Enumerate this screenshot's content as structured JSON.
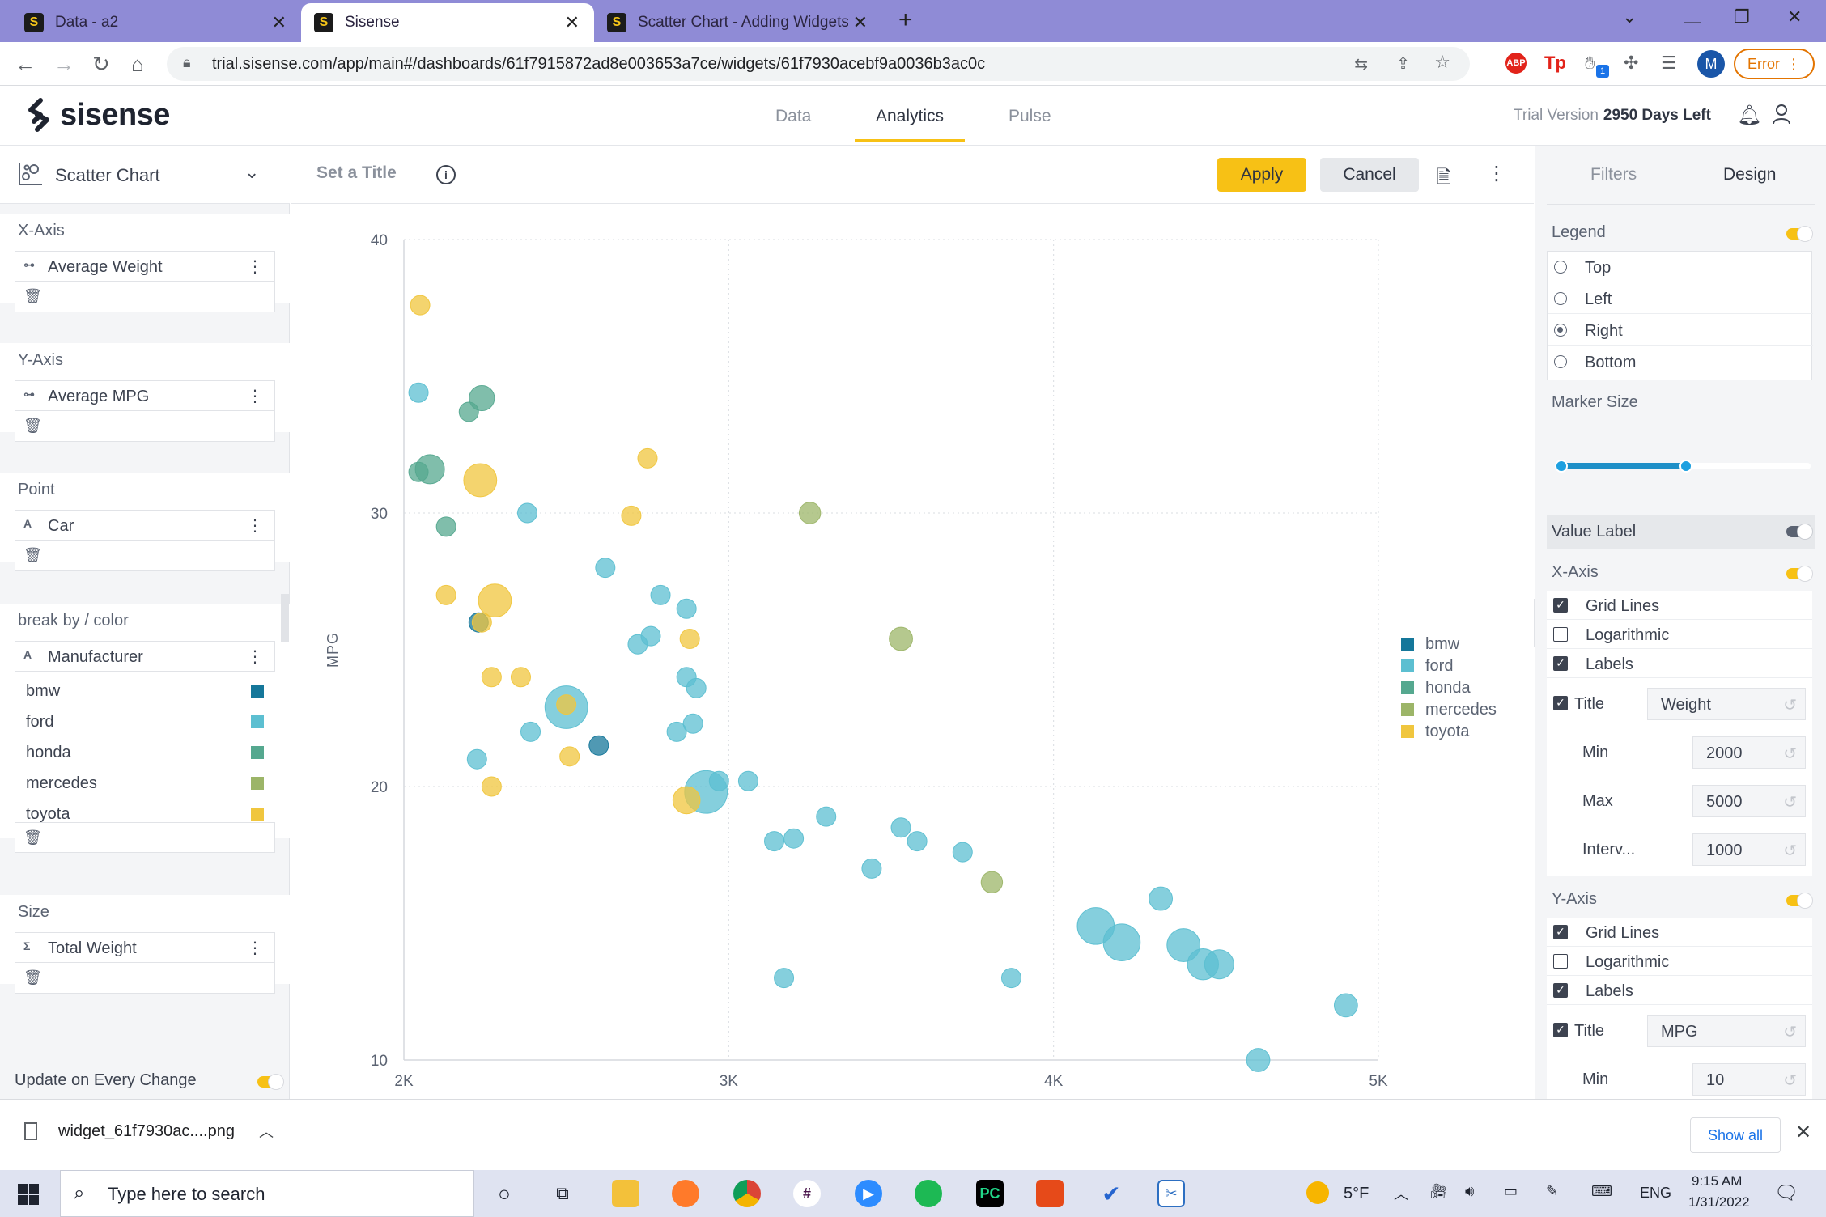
{
  "browser": {
    "tabs": [
      {
        "title": "Data - a2",
        "favicon": "S"
      },
      {
        "title": "Sisense",
        "favicon": "S"
      },
      {
        "title": "Scatter Chart - Adding Widgets t",
        "favicon": "S"
      }
    ],
    "new_tab": "+",
    "url": "trial.sisense.com/app/main#/dashboards/61f7915872ad8e003653a7ce/widgets/61f7930acebf9a0036b3ac0c",
    "profile_initial": "M",
    "error_label": "Error",
    "ext_badge": "1"
  },
  "app": {
    "logo_text": "sisense",
    "nav": [
      "Data",
      "Analytics",
      "Pulse"
    ],
    "active_nav": "Analytics",
    "trial_label": "Trial Version",
    "trial_days": "2950 Days Left"
  },
  "left_panel": {
    "chart_type": "Scatter Chart",
    "sections": {
      "xaxis": {
        "title": "X-Axis",
        "field": "Average Weight",
        "icon": "⊶"
      },
      "yaxis": {
        "title": "Y-Axis",
        "field": "Average MPG",
        "icon": "⊶"
      },
      "point": {
        "title": "Point",
        "field": "Car",
        "icon": "A"
      },
      "breakby": {
        "title": "break by / color",
        "field": "Manufacturer",
        "icon": "A"
      },
      "size": {
        "title": "Size",
        "field": "Total Weight",
        "icon": "Σ"
      }
    },
    "colors": [
      {
        "name": "bmw",
        "color": "#15779a"
      },
      {
        "name": "ford",
        "color": "#5cbfd1"
      },
      {
        "name": "honda",
        "color": "#55a88f"
      },
      {
        "name": "mercedes",
        "color": "#9cb568"
      },
      {
        "name": "toyota",
        "color": "#f0c63e"
      }
    ],
    "update_label": "Update on Every Change",
    "update_on": true
  },
  "center": {
    "title_placeholder": "Set a Title",
    "apply_label": "Apply",
    "cancel_label": "Cancel"
  },
  "chart_data": {
    "type": "scatter",
    "title": "",
    "xlabel": "",
    "ylabel": "MPG",
    "xlim": [
      2000,
      5000
    ],
    "ylim": [
      10,
      40
    ],
    "xticks": [
      {
        "v": 2000,
        "label": "2K"
      },
      {
        "v": 3000,
        "label": "3K"
      },
      {
        "v": 4000,
        "label": "4K"
      },
      {
        "v": 5000,
        "label": "5K"
      }
    ],
    "yticks": [
      10,
      20,
      30,
      40
    ],
    "grid": true,
    "legend": "right",
    "series": [
      {
        "name": "bmw",
        "color": "#15779a",
        "points": [
          [
            2230,
            26.0,
            1
          ],
          [
            2600,
            21.5,
            1
          ]
        ]
      },
      {
        "name": "ford",
        "color": "#5cbfd1",
        "points": [
          [
            2045,
            34.4,
            1
          ],
          [
            2380,
            30.0,
            1
          ],
          [
            2620,
            28.0,
            1
          ],
          [
            2720,
            25.2,
            1
          ],
          [
            2760,
            25.5,
            1
          ],
          [
            2790,
            27.0,
            1
          ],
          [
            2870,
            26.5,
            1
          ],
          [
            2870,
            24.0,
            1
          ],
          [
            2900,
            23.6,
            1
          ],
          [
            2890,
            22.3,
            1
          ],
          [
            2840,
            22.0,
            1
          ],
          [
            2500,
            22.9,
            2.2
          ],
          [
            2390,
            22.0,
            1
          ],
          [
            2225,
            21.0,
            1
          ],
          [
            2930,
            19.8,
            2.2
          ],
          [
            2970,
            20.2,
            1
          ],
          [
            3060,
            20.2,
            1
          ],
          [
            3140,
            18.0,
            1
          ],
          [
            3200,
            18.1,
            1
          ],
          [
            3300,
            18.9,
            1
          ],
          [
            3440,
            17.0,
            1
          ],
          [
            3530,
            18.5,
            1
          ],
          [
            3580,
            18.0,
            1
          ],
          [
            3720,
            17.6,
            1
          ],
          [
            3170,
            13.0,
            1
          ],
          [
            3870,
            13.0,
            1
          ],
          [
            4130,
            14.9,
            1.9
          ],
          [
            4210,
            14.3,
            1.9
          ],
          [
            4330,
            15.9,
            1.2
          ],
          [
            4400,
            14.2,
            1.7
          ],
          [
            4460,
            13.5,
            1.6
          ],
          [
            4510,
            13.5,
            1.5
          ],
          [
            4630,
            10.0,
            1.2
          ],
          [
            4900,
            12.0,
            1.2
          ]
        ]
      },
      {
        "name": "honda",
        "color": "#55a88f",
        "points": [
          [
            2045,
            31.5,
            1
          ],
          [
            2080,
            31.6,
            1.5
          ],
          [
            2200,
            33.7,
            1
          ],
          [
            2240,
            34.2,
            1.3
          ],
          [
            2130,
            29.5,
            1
          ]
        ]
      },
      {
        "name": "mercedes",
        "color": "#9cb568",
        "points": [
          [
            3250,
            30.0,
            1.1
          ],
          [
            3530,
            25.4,
            1.2
          ],
          [
            3810,
            16.5,
            1.1
          ]
        ]
      },
      {
        "name": "toyota",
        "color": "#f0c63e",
        "points": [
          [
            2050,
            37.6,
            1
          ],
          [
            2235,
            31.2,
            1.7
          ],
          [
            2130,
            27.0,
            1
          ],
          [
            2240,
            26.0,
            1
          ],
          [
            2280,
            26.8,
            1.7
          ],
          [
            2270,
            24.0,
            1
          ],
          [
            2360,
            24.0,
            1
          ],
          [
            2500,
            23.0,
            1
          ],
          [
            2510,
            21.1,
            1
          ],
          [
            2270,
            20.0,
            1
          ],
          [
            2750,
            32.0,
            1
          ],
          [
            2700,
            29.9,
            1
          ],
          [
            2880,
            25.4,
            1
          ],
          [
            2870,
            19.5,
            1.4
          ]
        ]
      }
    ]
  },
  "right_panel": {
    "tabs": [
      "Filters",
      "Design"
    ],
    "active_tab": "Design",
    "legend": {
      "label": "Legend",
      "on": true,
      "options": [
        "Top",
        "Left",
        "Right",
        "Bottom"
      ],
      "selected": "Right"
    },
    "marker_size_label": "Marker Size",
    "marker_size_range": [
      0,
      0.5
    ],
    "value_label": {
      "label": "Value Label",
      "on": false
    },
    "xaxis": {
      "label": "X-Axis",
      "on": true,
      "checks": [
        {
          "label": "Grid Lines",
          "on": true
        },
        {
          "label": "Logarithmic",
          "on": false
        },
        {
          "label": "Labels",
          "on": true
        }
      ],
      "title_label": "Title",
      "title_on": true,
      "title_value": "Weight",
      "inputs": [
        {
          "label": "Min",
          "value": "2000"
        },
        {
          "label": "Max",
          "value": "5000"
        },
        {
          "label": "Interv...",
          "value": "1000"
        }
      ]
    },
    "yaxis": {
      "label": "Y-Axis",
      "on": true,
      "checks": [
        {
          "label": "Grid Lines",
          "on": true
        },
        {
          "label": "Logarithmic",
          "on": false
        },
        {
          "label": "Labels",
          "on": true
        }
      ],
      "title_label": "Title",
      "title_on": true,
      "title_value": "MPG",
      "inputs": [
        {
          "label": "Min",
          "value": "10"
        }
      ]
    }
  },
  "downloads": {
    "file": "widget_61f7930ac....png",
    "show_all": "Show all"
  },
  "taskbar": {
    "search_placeholder": "Type here to search",
    "weather": "5°F",
    "lang": "ENG",
    "time": "9:15 AM",
    "date": "1/31/2022"
  }
}
